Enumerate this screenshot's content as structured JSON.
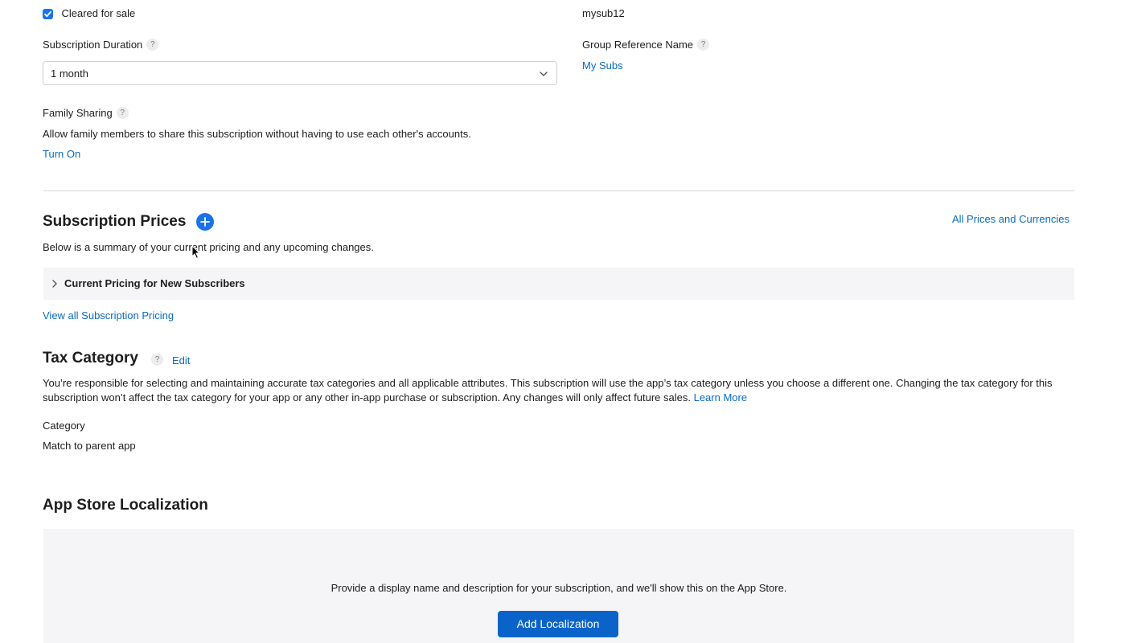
{
  "general": {
    "cleared_for_sale_label": "Cleared for sale",
    "cleared_for_sale_checked": true,
    "product_id_value": "mysub12",
    "duration_label": "Subscription Duration",
    "duration_value": "1 month",
    "group_ref_label": "Group Reference Name",
    "group_ref_value": "My Subs",
    "family_sharing_label": "Family Sharing",
    "family_sharing_desc": "Allow family members to share this subscription without having to use each other's accounts.",
    "family_sharing_action": "Turn On",
    "help_glyph": "?"
  },
  "prices": {
    "title": "Subscription Prices",
    "all_prices_link": "All Prices and Currencies",
    "summary": "Below is a summary of your current pricing and any upcoming changes.",
    "accordion_title": "Current Pricing for New Subscribers",
    "view_all_link": "View all Subscription Pricing"
  },
  "tax": {
    "title": "Tax Category",
    "edit_link": "Edit",
    "description": "You’re responsible for selecting and maintaining accurate tax categories and all applicable attributes. This subscription will use the app’s tax category unless you choose a different one. Changing the tax category for this subscription won’t affect the tax category for your app or any other in-app purchase or subscription. Any changes will only affect future sales.",
    "learn_more_link": "Learn More",
    "category_label": "Category",
    "category_value": "Match to parent app"
  },
  "localization": {
    "title": "App Store Localization",
    "message": "Provide a display name and description for your subscription, and we'll show this on the App Store.",
    "add_button": "Add Localization"
  },
  "colors": {
    "accent": "#1a73e8",
    "link": "#0a6bc2",
    "panel_bg": "#f5f5f7"
  }
}
